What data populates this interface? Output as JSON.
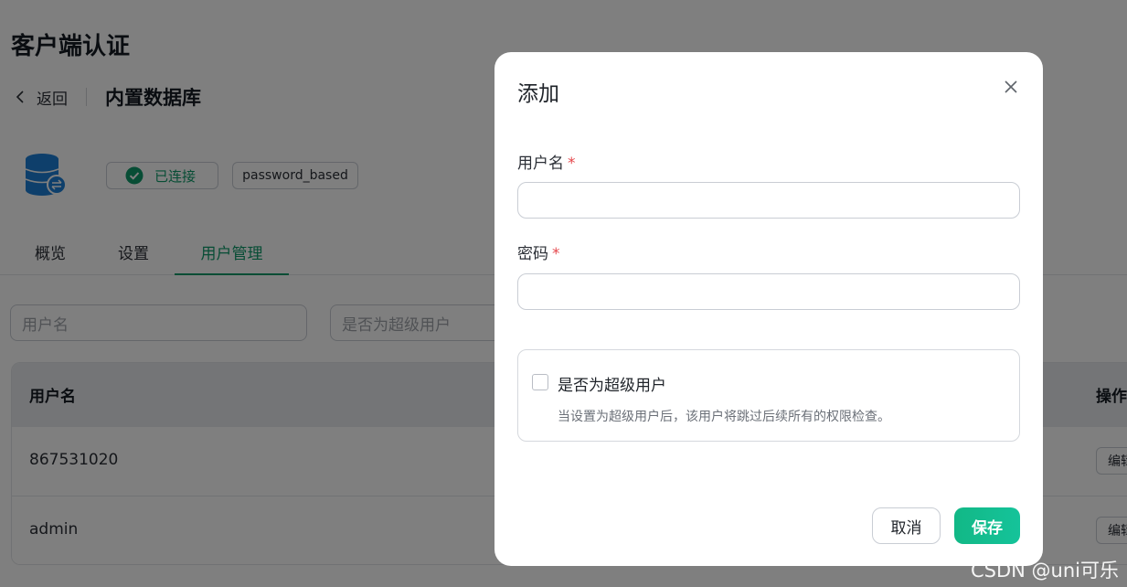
{
  "page": {
    "title": "客户端认证",
    "back_label": "返回",
    "breadcrumb_current": "内置数据库",
    "status_label": "已连接",
    "auth_type": "password_based",
    "tabs": [
      "概览",
      "设置",
      "用户管理"
    ],
    "active_tab": "用户管理",
    "filters": {
      "username_placeholder": "用户名",
      "superuser_placeholder": "是否为超级用户"
    },
    "table": {
      "columns": [
        "用户名",
        "操作"
      ],
      "rows": [
        {
          "username": "867531020",
          "action": "编辑"
        },
        {
          "username": "admin",
          "action": "编辑"
        }
      ]
    }
  },
  "dialog": {
    "title": "添加",
    "username_label": "用户名",
    "password_label": "密码",
    "required_mark": "*",
    "username_value": "",
    "password_value": "",
    "superuser_label": "是否为超级用户",
    "superuser_hint": "当设置为超级用户后，该用户将跳过后续所有的权限检查。",
    "superuser_checked": false,
    "cancel_label": "取消",
    "save_label": "保存"
  },
  "watermark": "CSDN @uni可乐",
  "colors": {
    "accent": "#0f9a6b",
    "save_button": "#12b886",
    "required": "#e5484d",
    "overlay": "rgba(0,0,0,0.5)"
  },
  "icons": [
    "chevron-left-icon",
    "database-icon",
    "check-circle-icon",
    "close-icon"
  ]
}
